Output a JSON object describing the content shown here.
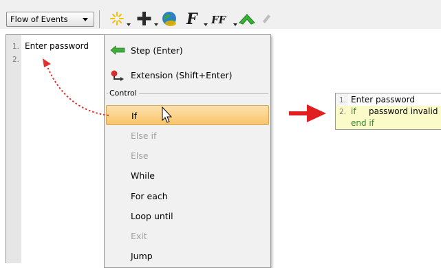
{
  "toolbar": {
    "flow_select": "Flow of Events",
    "icons": [
      "sparkle-icon",
      "plus-icon",
      "globe-icon",
      "italic-f-icon",
      "ff-icon",
      "chevron-up-icon"
    ],
    "f_label": "F",
    "ff_label": "FF"
  },
  "editor": {
    "lines": [
      {
        "num": "1.",
        "text": "Enter password"
      },
      {
        "num": "2.",
        "text": ""
      }
    ]
  },
  "menu": {
    "items": [
      {
        "label": "Step (Enter)",
        "icon": "green-arrow-left-icon",
        "enabled": true
      },
      {
        "label": "Extension (Shift+Enter)",
        "icon": "red-arrow-extension-icon",
        "enabled": true
      }
    ],
    "group_label": "Control",
    "control_items": [
      {
        "label": "If",
        "enabled": true,
        "selected": true
      },
      {
        "label": "Else if",
        "enabled": false
      },
      {
        "label": "Else",
        "enabled": false
      },
      {
        "label": "While",
        "enabled": true
      },
      {
        "label": "For each",
        "enabled": true
      },
      {
        "label": "Loop until",
        "enabled": true
      },
      {
        "label": "Exit",
        "enabled": false
      },
      {
        "label": "Jump",
        "enabled": true
      }
    ]
  },
  "result": {
    "lines": [
      {
        "num": "1.",
        "keyword": "",
        "text": "Enter password"
      },
      {
        "num": "2.",
        "keyword": "if",
        "text": "password invalid"
      },
      {
        "num": "",
        "keyword": "end if",
        "text": ""
      }
    ]
  },
  "colors": {
    "selection": "#f9c469",
    "keyword": "#2e8a2e",
    "arrow_red": "#e02020",
    "dotted_red": "#e03030"
  }
}
